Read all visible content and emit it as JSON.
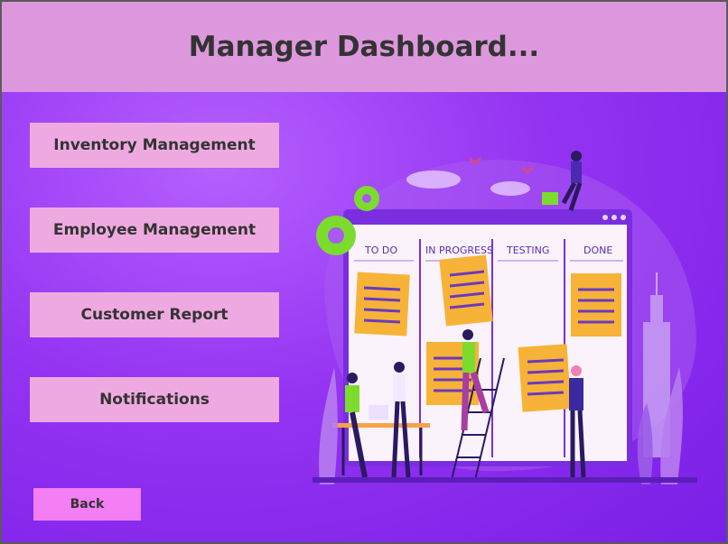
{
  "window": {
    "title": "Manager Dashboard..."
  },
  "menu": {
    "items": [
      {
        "label": "Inventory Management"
      },
      {
        "label": "Employee Management"
      },
      {
        "label": "Customer Report"
      },
      {
        "label": "Notifications"
      }
    ]
  },
  "footer": {
    "back_label": "Back"
  },
  "illustration": {
    "columns": [
      "TO DO",
      "IN PROGRESS",
      "TESTING",
      "DONE"
    ]
  },
  "colors": {
    "header_bg": "#dd98dd",
    "button_bg": "#eeaae0",
    "back_button_bg": "#f47ef4",
    "background": "#9433f2",
    "sticky_note": "#f7b337"
  }
}
